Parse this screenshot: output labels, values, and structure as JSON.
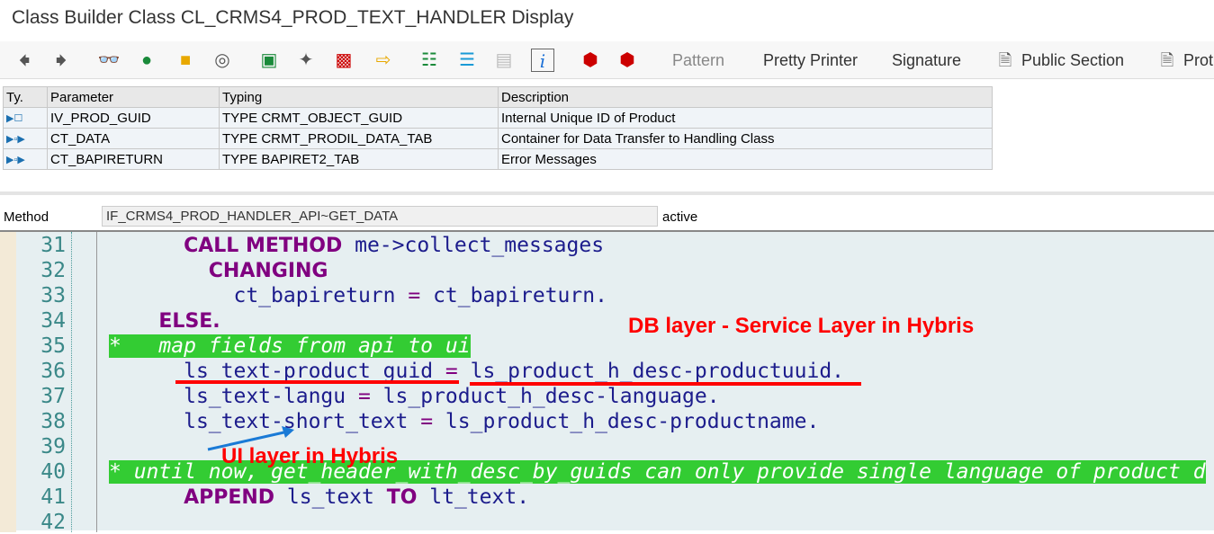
{
  "window": {
    "title": "Class Builder Class CL_CRMS4_PROD_TEXT_HANDLER Display"
  },
  "toolbar": {
    "icons": [
      "back-icon",
      "forward-icon",
      "other-object-icon",
      "display-change-icon",
      "active-inactive-icon",
      "check-icon",
      "activate-icon",
      "test-icon",
      "where-used-icon",
      "navigation-icon",
      "object-list-icon",
      "inheritance-icon",
      "display-list-icon",
      "doc-icon",
      "info-icon",
      "breakpoint-icon",
      "session-breakpoint-icon"
    ],
    "pattern": "Pattern",
    "pretty_printer": "Pretty Printer",
    "signature": "Signature",
    "public_section": "Public Section",
    "protected_section": "Prot"
  },
  "params": {
    "headers": [
      "Ty.",
      "Parameter",
      "Typing",
      "Description"
    ],
    "rows": [
      {
        "name": "IV_PROD_GUID",
        "typing": "TYPE CRMT_OBJECT_GUID",
        "desc": "Internal Unique ID of Product"
      },
      {
        "name": "CT_DATA",
        "typing": "TYPE CRMT_PRODIL_DATA_TAB",
        "desc": "Container for Data Transfer to Handling Class"
      },
      {
        "name": "CT_BAPIRETURN",
        "typing": "TYPE BAPIRET2_TAB",
        "desc": "Error Messages"
      }
    ]
  },
  "method": {
    "label": "Method",
    "value": "IF_CRMS4_PROD_HANDLER_API~GET_DATA",
    "status": "active"
  },
  "code": {
    "lines": [
      "31",
      "32",
      "33",
      "34",
      "35",
      "36",
      "37",
      "38",
      "39",
      "40",
      "41",
      "42"
    ],
    "l31a": "CALL METHOD",
    "l31b": " me->collect_messages",
    "l32": "CHANGING",
    "l33a": "ct_bapireturn ",
    "l33b": "=",
    "l33c": " ct_bapireturn.",
    "l34": "ELSE.",
    "l35": "*   map fields from api to ui",
    "l36a": "ls_text-product_guid ",
    "l36b": "=",
    "l36c": " ls_product_h_desc-productuuid.",
    "l37a": "ls_text-langu ",
    "l37b": "=",
    "l37c": " ls_product_h_desc-language.",
    "l38a": "ls_text-short_text ",
    "l38b": "=",
    "l38c": " ls_product_h_desc-productname.",
    "l40": "* until now, get_header_with_desc_by_guids can only provide single language of product d",
    "l41a": "APPEND",
    "l41b": " ls_text ",
    "l41c": "TO",
    "l41d": " lt_text."
  },
  "annotations": {
    "db": "DB layer - Service Layer in Hybris",
    "ui": "UI layer in Hybris"
  }
}
